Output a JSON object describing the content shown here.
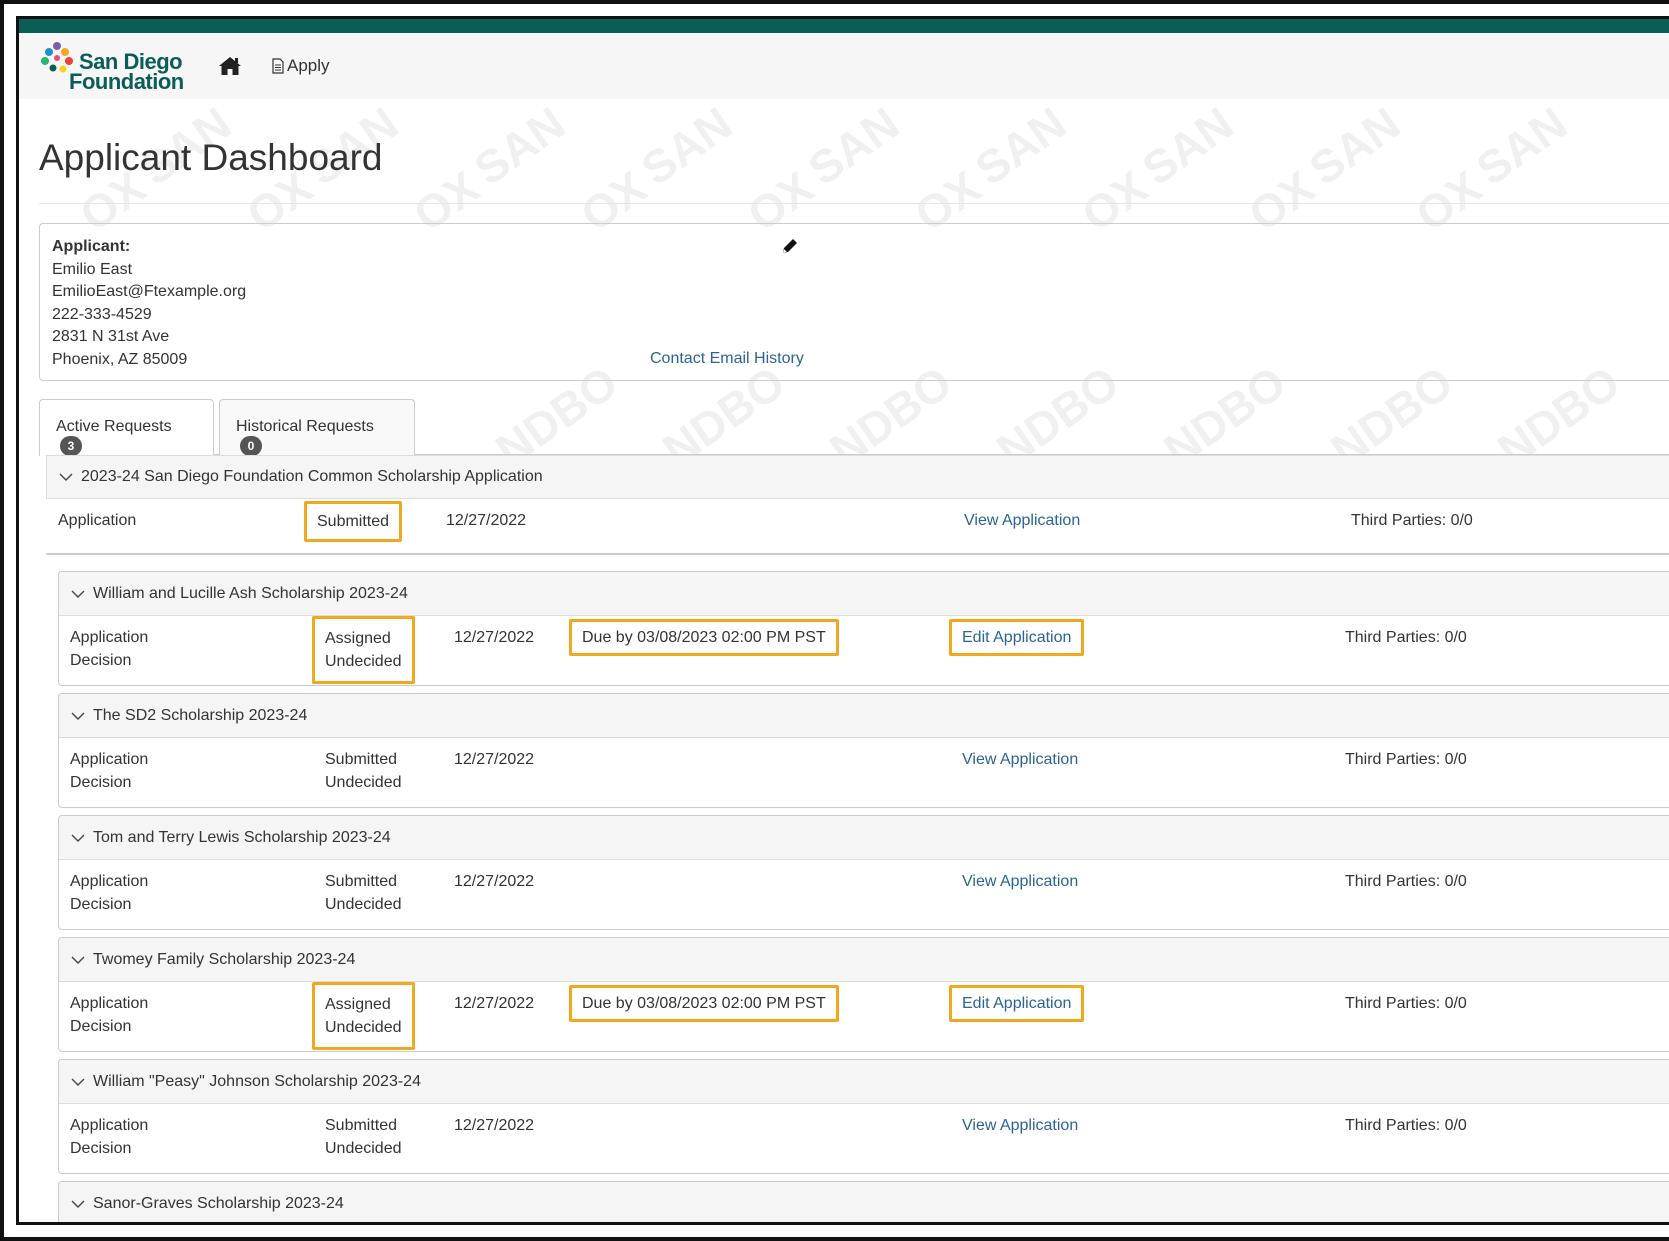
{
  "nav": {
    "logo_line1": "San Diego",
    "logo_line2": "Foundation",
    "apply_label": "Apply"
  },
  "watermark": {
    "text1": "SAN",
    "text2": "OX",
    "text3": "NDBO"
  },
  "page_title": "Applicant Dashboard",
  "applicant": {
    "label": "Applicant:",
    "name": "Emilio East",
    "email": "EmilioEast@Ftexample.org",
    "phone": "222-333-4529",
    "street": "2831 N 31st Ave",
    "city": "Phoenix, AZ 85009",
    "email_history_link": "Contact Email History"
  },
  "tabs": [
    {
      "label": "Active Requests",
      "count": "3"
    },
    {
      "label": "Historical Requests",
      "count": "0"
    }
  ],
  "main_group": {
    "title": "2023-24 San Diego Foundation Common Scholarship Application",
    "row": {
      "type": "Application",
      "status": "Submitted",
      "date": "12/27/2022",
      "action": "View Application",
      "third_parties": "Third Parties: 0/0"
    }
  },
  "sub_groups": [
    {
      "title": "William and Lucille Ash Scholarship 2023-24",
      "type1": "Application",
      "type2": "Decision",
      "status1": "Assigned",
      "status2": "Undecided",
      "date": "12/27/2022",
      "due": "Due by 03/08/2023 02:00 PM PST",
      "action": "Edit Application",
      "third_parties": "Third Parties: 0/0"
    },
    {
      "title": "The SD2 Scholarship 2023-24",
      "type1": "Application",
      "type2": "Decision",
      "status1": "Submitted",
      "status2": "Undecided",
      "date": "12/27/2022",
      "due": "",
      "action": "View Application",
      "third_parties": "Third Parties: 0/0"
    },
    {
      "title": "Tom and Terry Lewis Scholarship 2023-24",
      "type1": "Application",
      "type2": "Decision",
      "status1": "Submitted",
      "status2": "Undecided",
      "date": "12/27/2022",
      "due": "",
      "action": "View Application",
      "third_parties": "Third Parties: 0/0"
    },
    {
      "title": "Twomey Family Scholarship 2023-24",
      "type1": "Application",
      "type2": "Decision",
      "status1": "Assigned",
      "status2": "Undecided",
      "date": "12/27/2022",
      "due": "Due by 03/08/2023 02:00 PM PST",
      "action": "Edit Application",
      "third_parties": "Third Parties: 0/0"
    },
    {
      "title": "William \"Peasy\" Johnson Scholarship 2023-24",
      "type1": "Application",
      "type2": "Decision",
      "status1": "Submitted",
      "status2": "Undecided",
      "date": "12/27/2022",
      "due": "",
      "action": "View Application",
      "third_parties": "Third Parties: 0/0"
    },
    {
      "title": "Sanor-Graves Scholarship 2023-24"
    }
  ],
  "colors": {
    "brand_teal": "#0b5e55",
    "link": "#2a6496",
    "highlight": "#f0a81e"
  }
}
